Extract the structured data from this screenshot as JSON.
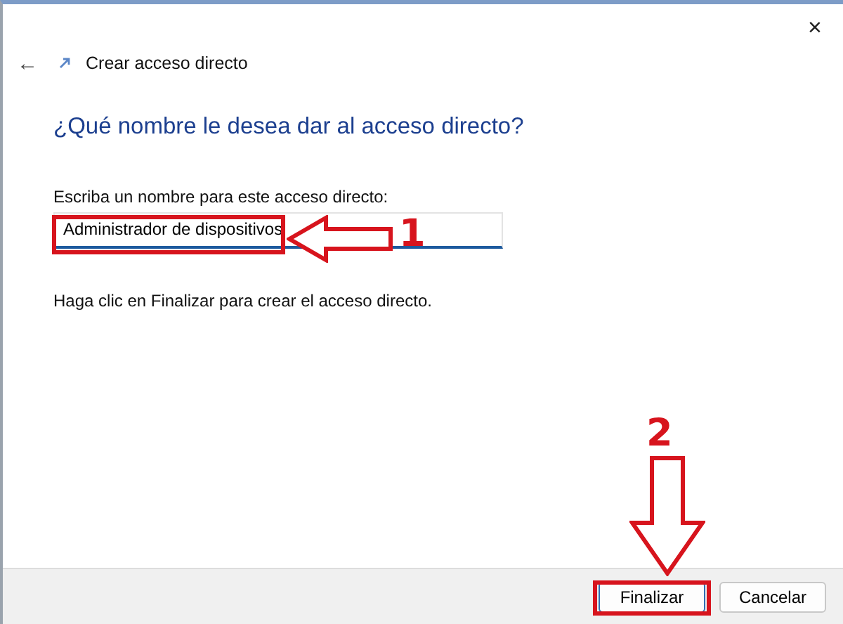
{
  "window": {
    "title": "Crear acceso directo",
    "close": "×",
    "back": "←"
  },
  "heading": "¿Qué nombre le desea dar al acceso directo?",
  "name_field": {
    "label": "Escriba un nombre para este acceso directo:",
    "value": "Administrador de dispositivos"
  },
  "hint": "Haga clic en Finalizar para crear el acceso directo.",
  "buttons": [
    {
      "label": "Finalizar",
      "kind": "primary"
    },
    {
      "label": "Cancelar",
      "kind": "secondary"
    }
  ],
  "annotations": [
    {
      "number": "1",
      "kind": "left-arrow"
    },
    {
      "number": "2",
      "kind": "down-arrow"
    }
  ]
}
